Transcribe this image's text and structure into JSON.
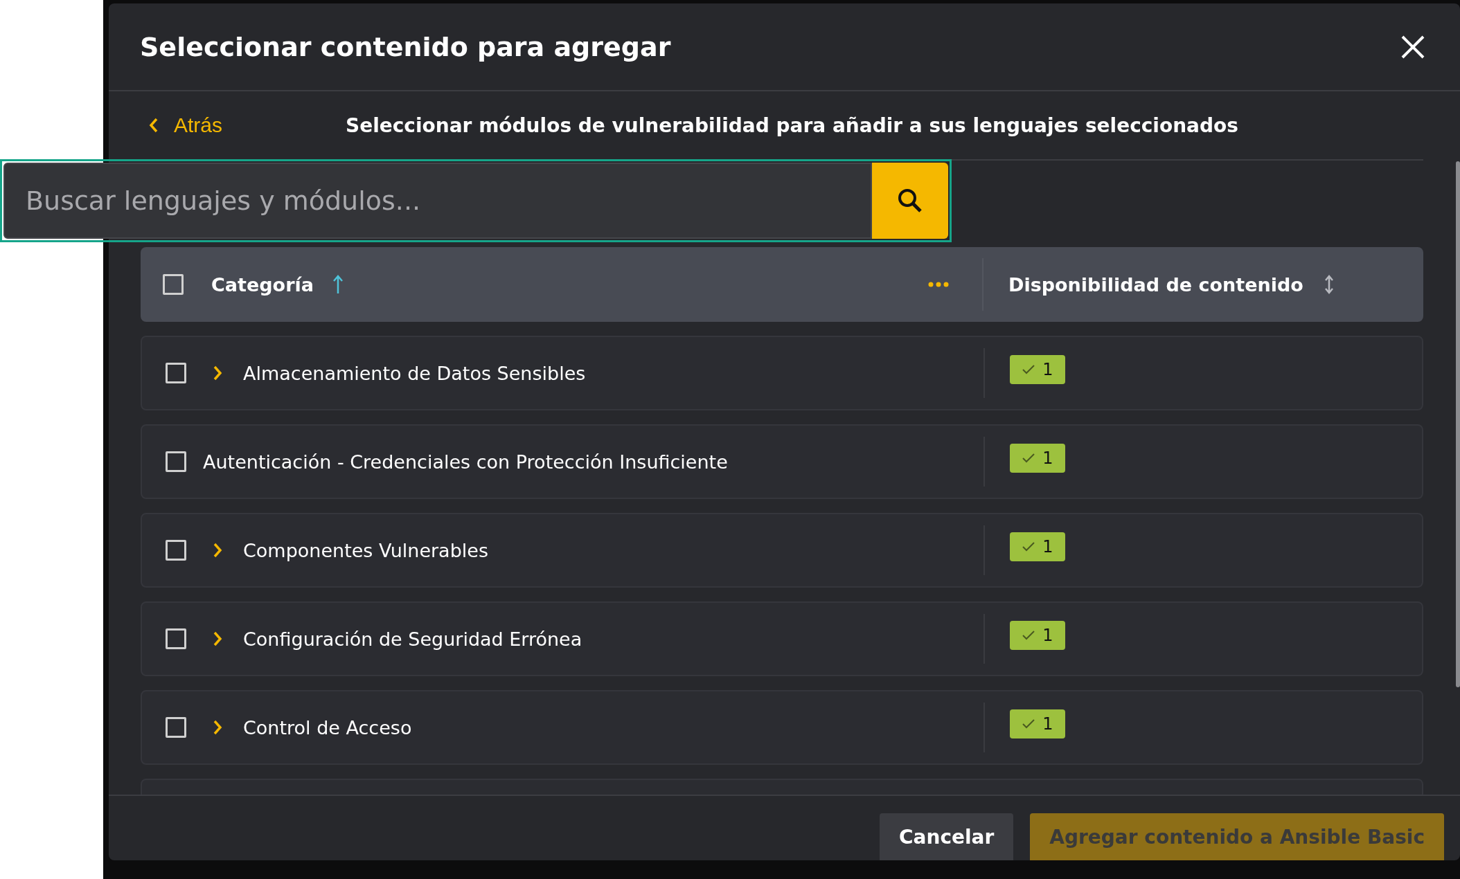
{
  "dialog": {
    "title": "Seleccionar contenido para agregar"
  },
  "back_link": "Atrás",
  "subtitle": "Seleccionar módulos de vulnerabilidad para añadir a sus lenguajes seleccionados",
  "search": {
    "placeholder": "Buscar lenguajes y módulos...",
    "focused": true
  },
  "table": {
    "header_checked": false,
    "columns": [
      {
        "label": "Categoría",
        "sort_ascending": true
      },
      {
        "label": "Disponibilidad de contenido",
        "sort_ascending": false
      }
    ],
    "rows": [
      {
        "name": "Almacenamiento de Datos Sensibles",
        "expandable": true,
        "checked": false,
        "count": "1"
      },
      {
        "name": "Autenticación - Credenciales con Protección Insuficiente",
        "expandable": false,
        "checked": false,
        "count": "1"
      },
      {
        "name": "Componentes Vulnerables",
        "expandable": true,
        "checked": false,
        "count": "1"
      },
      {
        "name": "Configuración de Seguridad Errónea",
        "expandable": true,
        "checked": false,
        "count": "1"
      },
      {
        "name": "Control de Acceso",
        "expandable": true,
        "checked": false,
        "count": "1"
      }
    ]
  },
  "buttons": [
    {
      "label": "Cancelar",
      "kind": "secondary",
      "disabled": false
    },
    {
      "label": "Agregar contenido a Ansible Basic",
      "kind": "primary",
      "disabled": true
    }
  ]
}
